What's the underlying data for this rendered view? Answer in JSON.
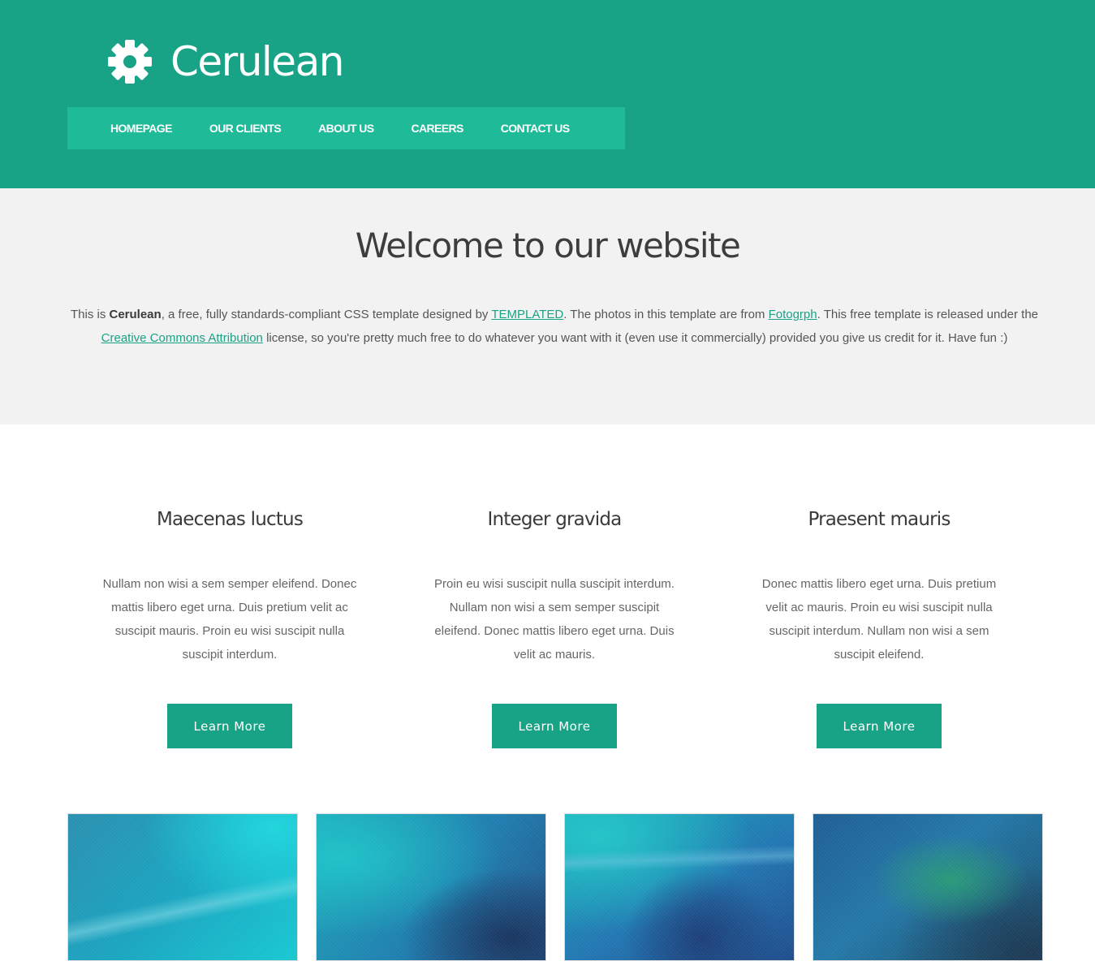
{
  "header": {
    "logo_icon": "gear-icon",
    "site_name": "Cerulean",
    "nav": [
      {
        "label": "HOMEPAGE"
      },
      {
        "label": "OUR CLIENTS"
      },
      {
        "label": "ABOUT US"
      },
      {
        "label": "CAREERS"
      },
      {
        "label": "CONTACT US"
      }
    ]
  },
  "welcome": {
    "title": "Welcome to our website",
    "intro": {
      "t1": "This is ",
      "brand": "Cerulean",
      "t2": ", a free, fully standards-compliant CSS template designed by ",
      "link1": "TEMPLATED",
      "t3": ". The photos in this template are from ",
      "link2": "Fotogrph",
      "t4": ". This free template is released under the ",
      "link3": "Creative Commons Attribution",
      "t5": " license, so you're pretty much free to do whatever you want with it (even use it commercially) provided you give us credit for it. Have fun :)"
    }
  },
  "features": [
    {
      "title": "Maecenas luctus",
      "text": "Nullam non wisi a sem semper eleifend. Donec mattis libero eget urna. Duis pretium velit ac suscipit mauris. Proin eu wisi suscipit nulla suscipit interdum.",
      "button": "Learn More"
    },
    {
      "title": "Integer gravida",
      "text": "Proin eu wisi suscipit nulla suscipit interdum. Nullam non wisi a sem semper suscipit eleifend. Donec mattis libero eget urna. Duis velit ac mauris.",
      "button": "Learn More"
    },
    {
      "title": "Praesent mauris",
      "text": "Donec mattis libero eget urna. Duis pretium velit ac mauris. Proin eu wisi suscipit nulla suscipit interdum. Nullam non wisi a sem suscipit eleifend.",
      "button": "Learn More"
    }
  ],
  "colors": {
    "brand": "#18a386",
    "nav_bar": "#1fba98",
    "welcome_bg": "#f2f2f2",
    "link": "#18a386"
  }
}
